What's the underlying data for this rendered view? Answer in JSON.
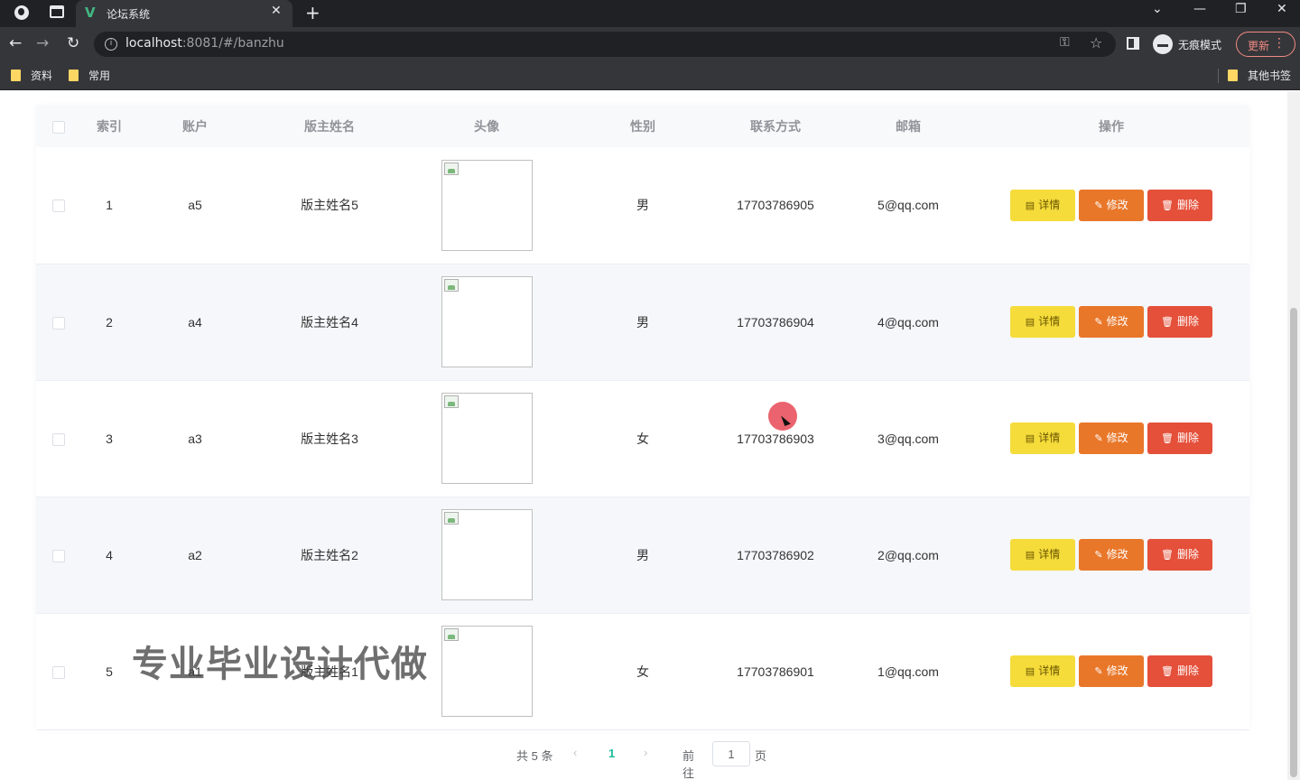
{
  "browser": {
    "tab_title": "论坛系统",
    "tab_favicon": "V",
    "url_host": "localhost",
    "url_rest": ":8081/#/banzhu",
    "incognito_label": "无痕模式",
    "update_label": "更新",
    "bookmarks": [
      "资料",
      "常用"
    ],
    "other_bookmarks": "其他书签"
  },
  "table": {
    "headers": [
      "索引",
      "账户",
      "版主姓名",
      "头像",
      "性别",
      "联系方式",
      "邮箱",
      "操作"
    ],
    "rows": [
      {
        "index": "1",
        "account": "a5",
        "name": "版主姓名5",
        "gender": "男",
        "phone": "17703786905",
        "email": "5@qq.com"
      },
      {
        "index": "2",
        "account": "a4",
        "name": "版主姓名4",
        "gender": "男",
        "phone": "17703786904",
        "email": "4@qq.com"
      },
      {
        "index": "3",
        "account": "a3",
        "name": "版主姓名3",
        "gender": "女",
        "phone": "17703786903",
        "email": "3@qq.com"
      },
      {
        "index": "4",
        "account": "a2",
        "name": "版主姓名2",
        "gender": "男",
        "phone": "17703786902",
        "email": "2@qq.com"
      },
      {
        "index": "5",
        "account": "a1",
        "name": "版主姓名1",
        "gender": "女",
        "phone": "17703786901",
        "email": "1@qq.com"
      }
    ],
    "actions": {
      "detail": "详情",
      "edit": "修改",
      "delete": "删除"
    }
  },
  "pagination": {
    "total": "共 5 条",
    "current_page": "1",
    "goto_label": "前往",
    "goto_value": "1",
    "page_suffix": "页"
  },
  "watermark": "专业毕业设计代做",
  "colors": {
    "detail": "#f5dc3b",
    "edit": "#e9772a",
    "delete": "#e4503a",
    "page_active": "#1abc9c"
  }
}
